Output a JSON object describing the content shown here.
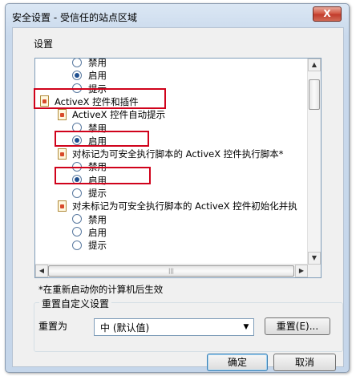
{
  "window": {
    "title": "安全设置 - 受信任的站点区域",
    "close_label": "X"
  },
  "settings_group": {
    "label": "设置"
  },
  "settings_list": [
    {
      "kind": "radio",
      "label": "禁用",
      "checked": false
    },
    {
      "kind": "radio",
      "label": "启用",
      "checked": true
    },
    {
      "kind": "radio",
      "label": "提示",
      "checked": false
    },
    {
      "kind": "category",
      "label": "ActiveX 控件和插件"
    },
    {
      "kind": "subcategory",
      "label": "ActiveX 控件自动提示"
    },
    {
      "kind": "radio",
      "label": "禁用",
      "checked": false
    },
    {
      "kind": "radio",
      "label": "启用",
      "checked": true
    },
    {
      "kind": "subcategory",
      "label": "对标记为可安全执行脚本的 ActiveX 控件执行脚本*"
    },
    {
      "kind": "radio",
      "label": "禁用",
      "checked": false
    },
    {
      "kind": "radio",
      "label": "启用",
      "checked": true
    },
    {
      "kind": "radio",
      "label": "提示",
      "checked": false
    },
    {
      "kind": "subcategory",
      "label": "对未标记为可安全执行脚本的 ActiveX 控件初始化并执"
    },
    {
      "kind": "radio",
      "label": "禁用",
      "checked": false
    },
    {
      "kind": "radio",
      "label": "启用",
      "checked": false
    },
    {
      "kind": "radio",
      "label": "提示",
      "checked": false
    }
  ],
  "note": "*在重新启动你的计算机后生效",
  "reset_group": {
    "legend": "重置自定义设置",
    "reset_to_label": "重置为",
    "level_value": "中 (默认值)",
    "reset_button": "重置(E)..."
  },
  "footer": {
    "ok": "确定",
    "cancel": "取消"
  },
  "colors": {
    "highlight": "#d0021b",
    "window_frame": "#c9d9ec"
  }
}
